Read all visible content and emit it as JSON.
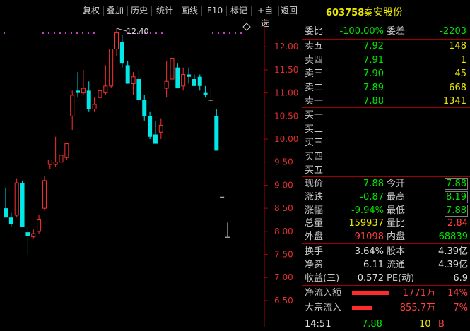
{
  "toolbar": {
    "buttons": [
      "复权",
      "叠加",
      "历史",
      "统计",
      "画线",
      "F10",
      "标记",
      "+自选",
      "返回"
    ],
    "diamond_icon": "diamond-icon"
  },
  "chart_data": {
    "type": "candlestick",
    "annotation": "12.40",
    "y_ticks": [
      "12.00",
      "11.50",
      "11.00",
      "10.50",
      "10.00",
      "9.50",
      "9.00",
      "8.50",
      "8.00",
      "7.50",
      "7.00",
      "6.50"
    ],
    "ylim": [
      6.3,
      12.6
    ],
    "candles": [
      {
        "o": 8.5,
        "h": 8.95,
        "l": 8.35,
        "c": 8.3
      },
      {
        "o": 8.3,
        "h": 8.4,
        "l": 8.1,
        "c": 8.15
      },
      {
        "o": 8.35,
        "h": 9.15,
        "l": 8.3,
        "c": 9.05
      },
      {
        "o": 9.05,
        "h": 9.1,
        "l": 8.1,
        "c": 8.1
      },
      {
        "o": 7.98,
        "h": 8.1,
        "l": 7.5,
        "c": 7.9
      },
      {
        "o": 7.88,
        "h": 8.05,
        "l": 7.85,
        "c": 7.95
      },
      {
        "o": 8.0,
        "h": 8.35,
        "l": 7.95,
        "c": 8.25
      },
      {
        "o": 8.5,
        "h": 9.2,
        "l": 8.45,
        "c": 9.1
      },
      {
        "o": 9.45,
        "h": 9.55,
        "l": 9.35,
        "c": 9.55
      },
      {
        "o": 9.45,
        "h": 10.05,
        "l": 9.4,
        "c": 9.5
      },
      {
        "o": 9.5,
        "h": 9.6,
        "l": 9.35,
        "c": 9.65
      },
      {
        "o": 9.6,
        "h": 9.9,
        "l": 9.55,
        "c": 9.9
      },
      {
        "o": 10.5,
        "h": 11.05,
        "l": 10.2,
        "c": 10.95
      },
      {
        "o": 11.05,
        "h": 11.45,
        "l": 10.9,
        "c": 11.0
      },
      {
        "o": 11.0,
        "h": 11.5,
        "l": 10.95,
        "c": 11.1
      },
      {
        "o": 11.05,
        "h": 11.25,
        "l": 10.6,
        "c": 10.65
      },
      {
        "o": 10.65,
        "h": 10.9,
        "l": 10.6,
        "c": 10.75
      },
      {
        "o": 10.9,
        "h": 11.2,
        "l": 10.85,
        "c": 11.05
      },
      {
        "o": 11.0,
        "h": 11.6,
        "l": 10.95,
        "c": 11.15
      },
      {
        "o": 11.15,
        "h": 11.9,
        "l": 11.1,
        "c": 11.95
      },
      {
        "o": 11.95,
        "h": 12.4,
        "l": 11.8,
        "c": 12.3
      },
      {
        "o": 12.1,
        "h": 12.25,
        "l": 11.55,
        "c": 11.65
      },
      {
        "o": 11.6,
        "h": 11.7,
        "l": 11.2,
        "c": 11.2
      },
      {
        "o": 11.2,
        "h": 11.45,
        "l": 10.95,
        "c": 11.35
      },
      {
        "o": 11.3,
        "h": 11.5,
        "l": 10.75,
        "c": 10.85
      },
      {
        "o": 10.85,
        "h": 10.95,
        "l": 10.4,
        "c": 10.5
      },
      {
        "o": 10.5,
        "h": 10.6,
        "l": 10.0,
        "c": 10.05
      },
      {
        "o": 10.1,
        "h": 10.4,
        "l": 9.95,
        "c": 9.9
      },
      {
        "o": 10.15,
        "h": 10.45,
        "l": 10.0,
        "c": 10.3
      },
      {
        "o": 11.1,
        "h": 11.7,
        "l": 10.9,
        "c": 11.25
      },
      {
        "o": 11.3,
        "h": 12.05,
        "l": 11.2,
        "c": 11.75
      },
      {
        "o": 11.55,
        "h": 11.65,
        "l": 11.1,
        "c": 11.1
      },
      {
        "o": 11.15,
        "h": 11.55,
        "l": 11.05,
        "c": 11.4
      },
      {
        "o": 11.4,
        "h": 11.55,
        "l": 11.2,
        "c": 11.35
      },
      {
        "o": 11.3,
        "h": 11.4,
        "l": 11.15,
        "c": 11.15
      },
      {
        "o": 11.35,
        "h": 11.4,
        "l": 11.05,
        "c": 11.15
      },
      {
        "o": 11.0,
        "h": 11.15,
        "l": 10.9,
        "c": 10.95
      },
      {
        "o": 10.85,
        "h": 11.1,
        "l": 10.8,
        "c": 10.85
      },
      {
        "o": 10.5,
        "h": 10.65,
        "l": 9.75,
        "c": 9.75
      },
      {
        "o": 8.75,
        "h": 8.75,
        "l": 8.75,
        "c": 8.75
      },
      {
        "o": 7.88,
        "h": 8.19,
        "l": 7.88,
        "c": 7.88
      }
    ]
  },
  "quote": {
    "code": "603758",
    "name": "秦安股份",
    "weibi": {
      "label": "委比",
      "value": "-100.00%"
    },
    "weicha": {
      "label": "委差",
      "value": "-2203"
    },
    "sell": [
      {
        "label": "卖五",
        "price": "7.92",
        "vol": "148"
      },
      {
        "label": "卖四",
        "price": "7.91",
        "vol": "1"
      },
      {
        "label": "卖三",
        "price": "7.90",
        "vol": "45"
      },
      {
        "label": "卖二",
        "price": "7.89",
        "vol": "668"
      },
      {
        "label": "卖一",
        "price": "7.88",
        "vol": "1341"
      }
    ],
    "buy": [
      {
        "label": "买一"
      },
      {
        "label": "买二"
      },
      {
        "label": "买三"
      },
      {
        "label": "买四"
      },
      {
        "label": "买五"
      }
    ],
    "stats": [
      {
        "l1": "现价",
        "v1": "7.88",
        "l2": "今开",
        "v2": "7.88"
      },
      {
        "l1": "涨跌",
        "v1": "-0.87",
        "l2": "最高",
        "v2": "8.19"
      },
      {
        "l1": "涨幅",
        "v1": "-9.94%",
        "l2": "最低",
        "v2": "7.88"
      },
      {
        "l1": "总量",
        "v1": "159937",
        "l2": "量比",
        "v2": "2.84"
      },
      {
        "l1": "外盘",
        "v1": "91098",
        "l2": "内盘",
        "v2": "68839"
      }
    ],
    "fin": [
      {
        "l1": "换手",
        "v1": "3.64%",
        "l2": "股本",
        "v2": "4.39亿"
      },
      {
        "l1": "净资",
        "v1": "6.11",
        "l2": "流通",
        "v2": "4.39亿"
      },
      {
        "l1": "收益(三)",
        "v1": "0.572",
        "l2": "PE(动)",
        "v2": "6.9"
      }
    ],
    "flows": [
      {
        "label": "净流入额",
        "amount": "1771万",
        "pct": "14%",
        "fill": 0.86
      },
      {
        "label": "大宗流入",
        "amount": "855.7万",
        "pct": "7%",
        "fill": 0.45
      }
    ],
    "tick": {
      "time": "14:51",
      "price": "7.88",
      "vol": "10",
      "dir": "B"
    }
  }
}
